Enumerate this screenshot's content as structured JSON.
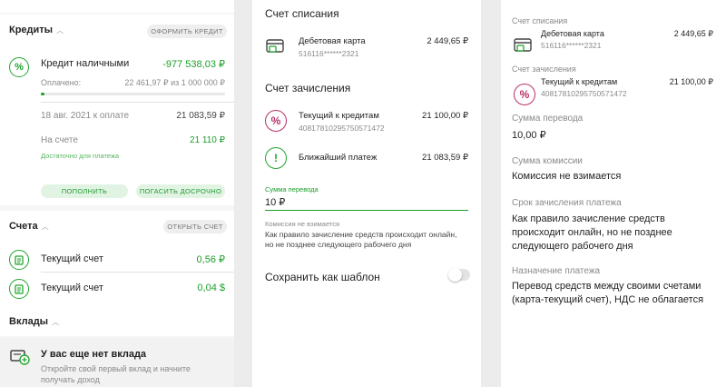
{
  "left": {
    "credits": {
      "title": "Кредиты",
      "action": "ОФОРМИТЬ КРЕДИТ",
      "loan_name": "Кредит наличными",
      "loan_amount": "-977 538,03 ₽",
      "paid_label": "Оплачено:",
      "paid_value": "22 461,97 ₽ из 1 000 000 ₽",
      "paid_fraction": 0.022,
      "due_label": "18 авг. 2021 к оплате",
      "due_value": "21 083,59 ₽",
      "on_account_label": "На счете",
      "on_account_value": "21 110 ₽",
      "sufficient": "Достаточно для платежа",
      "btn_topup": "ПОПОЛНИТЬ",
      "btn_early": "ПОГАСИТЬ ДОСРОЧНО"
    },
    "accounts": {
      "title": "Счета",
      "action": "ОТКРЫТЬ СЧЕТ",
      "items": [
        {
          "name": "Текущий счет",
          "value": "0,56 ₽"
        },
        {
          "name": "Текущий счет",
          "value": "0,04 $"
        }
      ]
    },
    "deposits": {
      "title": "Вклады",
      "empty_title": "У вас еще нет вклада",
      "empty_sub_1": "Откройте свой первый вклад и начните",
      "empty_sub_2": "получать доход"
    }
  },
  "middle": {
    "debit_title": "Счет списания",
    "debit_card_name": "Дебетовая карта",
    "debit_card_number": "516116******2321",
    "debit_card_value": "2 449,65 ₽",
    "credit_title": "Счет зачисления",
    "credit_acc_name": "Текущий к кредитам",
    "credit_acc_number": "40817810295750571472",
    "credit_acc_value": "21 100,00 ₽",
    "next_payment_label": "Ближайший платеж",
    "next_payment_value": "21 083,59 ₽",
    "amount_label": "Сумма перевода",
    "amount_value": "10 ₽",
    "commission_title": "Комиссия не взимается",
    "commission_text_1": "Как правило зачисление средств происходит онлайн,",
    "commission_text_2": "но не позднее следующего рабочего дня",
    "save_template": "Сохранить как шаблон"
  },
  "right": {
    "debit_title": "Счет списания",
    "debit_card_name": "Дебетовая карта",
    "debit_card_number": "516116******2321",
    "debit_card_value": "2 449,65 ₽",
    "credit_title": "Счет зачисления",
    "credit_acc_name": "Текущий к кредитам",
    "credit_acc_number": "40817810295750571472",
    "credit_acc_value": "21 100,00 ₽",
    "amount_label": "Сумма перевода",
    "amount_value": "10,00 ₽",
    "commission_label": "Сумма комиссии",
    "commission_value": "Комиссия не взимается",
    "term_label": "Срок зачисления платежа",
    "term_value_1": "Как правило зачисление средств",
    "term_value_2": "происходит онлайн, но не позднее",
    "term_value_3": "следующего рабочего дня",
    "purpose_label": "Назначение платежа",
    "purpose_value_1": "Перевод средств между своими счетами",
    "purpose_value_2": "(карта-текущий счет), НДС не облагается"
  },
  "colors": {
    "green": "#1a9f29",
    "pink": "#b8306a",
    "muted": "#8a8a8a"
  }
}
